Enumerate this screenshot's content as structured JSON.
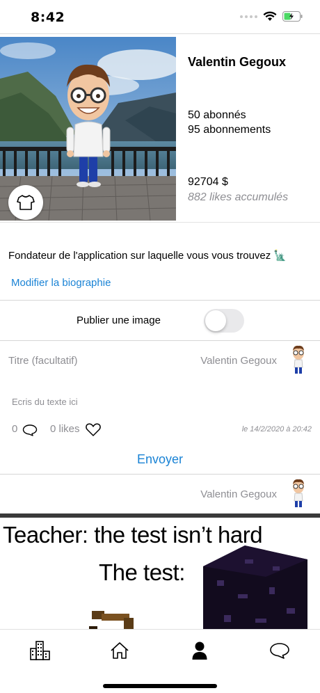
{
  "status_bar": {
    "time": "8:42"
  },
  "profile": {
    "name": "Valentin Gegoux",
    "followers": "50 abonnés",
    "following": "95 abonnements",
    "money": "92704 $",
    "likes": "882 likes accumulés"
  },
  "bio": {
    "text": "Fondateur de l'application sur laquelle vous vous trouvez 🗽",
    "edit_label": "Modifier la biographie"
  },
  "publish": {
    "label": "Publier une image",
    "toggle_on": false
  },
  "draft_post": {
    "title_placeholder": "Titre (facultatif)",
    "author": "Valentin Gegoux",
    "text_placeholder": "Ecris du texte ici",
    "comments": "0",
    "likes": "0 likes",
    "date": "le 14/2/2020 à 20:42",
    "send_label": "Envoyer"
  },
  "feed_post": {
    "author": "Valentin Gegoux",
    "meme_line1": "Teacher:  the test isn’t hard",
    "meme_line2": "The test:"
  },
  "tab_bar": {
    "items": [
      "city-icon",
      "home-icon",
      "profile-icon",
      "chat-icon"
    ],
    "active": "profile-icon"
  },
  "colors": {
    "accent": "#1a83d5",
    "secondary_text": "#8e8e93",
    "toggle_off": "#e9e9eb"
  }
}
